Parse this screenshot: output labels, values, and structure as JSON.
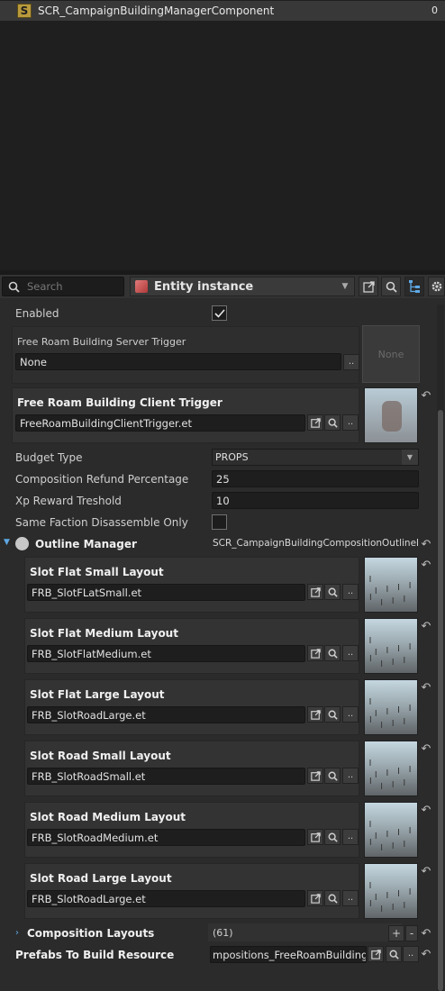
{
  "component_list": {
    "items": [
      {
        "label": "SCR_CampaignBuildingManagerComponent",
        "count": "0",
        "icon_letter": "S"
      }
    ]
  },
  "toolbar": {
    "search_placeholder": "Search",
    "entity_selector": "Entity instance"
  },
  "properties": {
    "enabled_label": "Enabled",
    "enabled_checked": true,
    "server_trigger": {
      "label": "Free Roam Building Server Trigger",
      "value": "None",
      "thumbnail_text": "None"
    },
    "client_trigger": {
      "label": "Free Roam Building Client Trigger",
      "value": "FreeRoamBuildingClientTrigger.et"
    },
    "budget_type": {
      "label": "Budget Type",
      "value": "PROPS"
    },
    "refund_percentage": {
      "label": "Composition Refund Percentage",
      "value": "25"
    },
    "xp_reward": {
      "label": "Xp Reward Treshold",
      "value": "10"
    },
    "same_faction": {
      "label": "Same Faction Disassemble Only",
      "checked": false
    },
    "outline_manager": {
      "label": "Outline Manager",
      "value": "SCR_CampaignBuildingCompositionOutlineMana"
    },
    "slot_layouts": [
      {
        "label": "Slot Flat Small Layout",
        "value": "FRB_SlotFLatSmall.et"
      },
      {
        "label": "Slot Flat Medium Layout",
        "value": "FRB_SlotFlatMedium.et"
      },
      {
        "label": "Slot Flat Large Layout",
        "value": "FRB_SlotRoadLarge.et"
      },
      {
        "label": "Slot Road Small Layout",
        "value": "FRB_SlotRoadSmall.et"
      },
      {
        "label": "Slot Road Medium Layout",
        "value": "FRB_SlotRoadMedium.et"
      },
      {
        "label": "Slot Road Large Layout",
        "value": "FRB_SlotRoadLarge.et"
      }
    ],
    "composition_layouts": {
      "label": "Composition Layouts",
      "value": "(61)"
    },
    "prefabs_resource": {
      "label": "Prefabs To Build Resource",
      "value": "mpositions_FreeRoamBuilding.conf"
    }
  },
  "buttons": {
    "browse": "..",
    "add": "+",
    "remove": "-"
  },
  "colors": {
    "component_icon": "#b89a3c",
    "entity_cube": "#c04a4a",
    "panel_bg": "#2b2b2b",
    "card_bg": "#333333"
  }
}
